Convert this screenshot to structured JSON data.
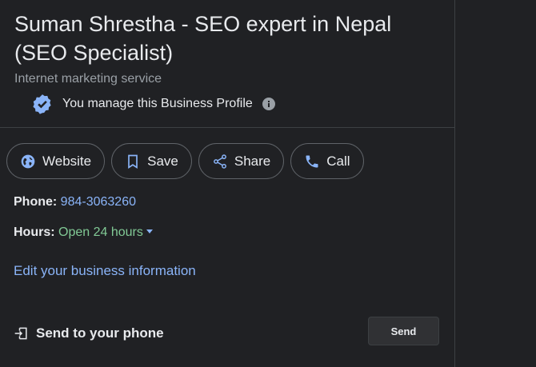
{
  "business": {
    "name": "Suman Shrestha - SEO expert in Nepal (SEO Specialist)",
    "category": "Internet marketing service",
    "managed_text": "You manage this Business Profile"
  },
  "actions": [
    {
      "label": "Website",
      "icon": "globe-icon"
    },
    {
      "label": "Save",
      "icon": "bookmark-icon"
    },
    {
      "label": "Share",
      "icon": "share-icon"
    },
    {
      "label": "Call",
      "icon": "phone-icon"
    }
  ],
  "details": {
    "phone_label": "Phone:",
    "phone_value": "984-3063260",
    "hours_label": "Hours:",
    "hours_value": "Open 24 hours"
  },
  "edit_link": "Edit your business information",
  "send": {
    "label": "Send to your phone",
    "button": "Send"
  },
  "colors": {
    "background": "#202124",
    "link": "#8ab4f8",
    "open_status": "#81c995",
    "secondary_text": "#9aa0a6"
  }
}
